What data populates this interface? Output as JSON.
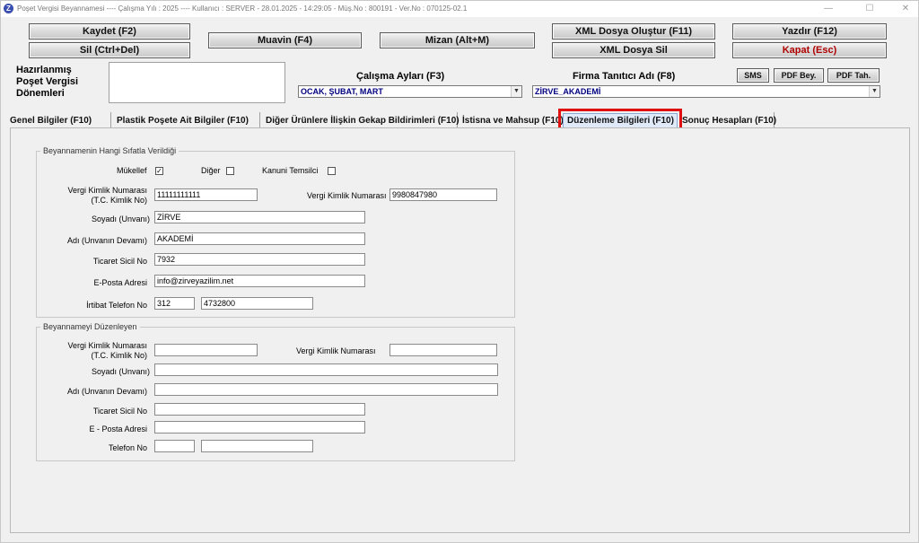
{
  "window": {
    "title": "Poşet Vergisi Beyannamesi  ----  Çalışma Yılı : 2025  ----  Kullanıcı : SERVER - 28.01.2025 - 14:29:05 - Müş.No : 800191 - Ver.No : 070125-02.1",
    "app_icon": "Z",
    "minimize": "—",
    "maximize": "☐",
    "close": "✕"
  },
  "toolbar": {
    "save": "Kaydet (F2)",
    "delete": "Sil (Ctrl+Del)",
    "muavin": "Muavin (F4)",
    "mizan": "Mizan (Alt+M)",
    "xml_create": "XML Dosya Oluştur (F11)",
    "xml_delete": "XML Dosya Sil",
    "print": "Yazdır (F12)",
    "close": "Kapat (Esc)",
    "sms": "SMS",
    "pdf_bey": "PDF Bey.",
    "pdf_tah": "PDF Tah."
  },
  "header": {
    "periods_label_1": "Hazırlanmış",
    "periods_label_2": "Poşet Vergisi",
    "periods_label_3": "Dönemleri",
    "months_label": "Çalışma Ayları (F3)",
    "months_value": "OCAK, ŞUBAT, MART",
    "company_label": "Firma Tanıtıcı Adı (F8)",
    "company_value": "ZİRVE_AKADEMİ"
  },
  "tabs": [
    {
      "label": "Genel Bilgiler (F10)"
    },
    {
      "label": "Plastik Poşete Ait Bilgiler (F10)"
    },
    {
      "label": "Diğer Ürünlere İlişkin Gekap Bildirimleri (F10)"
    },
    {
      "label": "İstisna ve Mahsup (F10)"
    },
    {
      "label": "Düzenleme Bilgileri (F10)",
      "active": true
    },
    {
      "label": "Sonuç Hesapları (F10)"
    }
  ],
  "group1": {
    "legend": "Beyannamenin Hangi Sıfatla Verildiği",
    "mukellef_label": "Mükellef",
    "mukellef_check": "✓",
    "diger_label": "Diğer",
    "kanuni_label": "Kanuni Temsilci",
    "vkn_label_1": "Vergi Kimlik Numarası",
    "vkn_label_2": "(T.C. Kimlik No)",
    "vkn_value": "11111111111",
    "vkn2_label": "Vergi Kimlik Numarası",
    "vkn2_value": "9980847980",
    "soyadi_label": "Soyadı (Unvanı)",
    "soyadi_value": "ZİRVE",
    "adi_label": "Adı (Unvanın Devamı)",
    "adi_value": "AKADEMİ",
    "ticaret_label": "Ticaret Sicil No",
    "ticaret_value": "7932",
    "eposta_label": "E-Posta Adresi",
    "eposta_value": "info@zirveyazilim.net",
    "tel_label": "İrtibat Telefon No",
    "tel_area": "312",
    "tel_number": "4732800"
  },
  "group2": {
    "legend": "Beyannameyi Düzenleyen",
    "vkn_label_1": "Vergi Kimlik Numarası",
    "vkn_label_2": "(T.C. Kimlik No)",
    "vkn_value": "",
    "vkn2_label": "Vergi Kimlik Numarası",
    "vkn2_value": "",
    "soyadi_label": "Soyadı (Unvanı)",
    "soyadi_value": "",
    "adi_label": "Adı (Unvanın Devamı)",
    "adi_value": "",
    "ticaret_label": "Ticaret Sicil No",
    "ticaret_value": "",
    "eposta_label": "E - Posta Adresi",
    "eposta_value": "",
    "tel_label": "Telefon No",
    "tel_area": "",
    "tel_number": ""
  }
}
